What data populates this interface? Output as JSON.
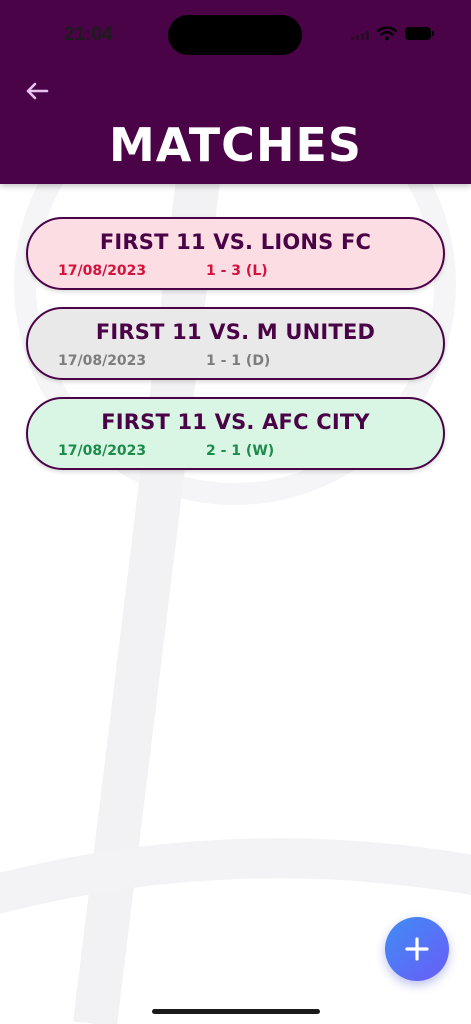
{
  "status_bar": {
    "time": "21:04"
  },
  "header": {
    "title": "MATCHES"
  },
  "colors": {
    "brand": "#4a0347",
    "loss_bg": "#fddde4",
    "loss_text": "#d4123c",
    "draw_bg": "#e9e9e9",
    "draw_text": "#7d7d7d",
    "win_bg": "#d9f6e5",
    "win_text": "#1c8c4a",
    "fab": "#5a74f5"
  },
  "matches": [
    {
      "title": "FIRST 11 VS. LIONS FC",
      "date": "17/08/2023",
      "score": "1 - 3 (L)",
      "result": "loss"
    },
    {
      "title": "FIRST 11 VS. M UNITED",
      "date": "17/08/2023",
      "score": "1 - 1 (D)",
      "result": "draw"
    },
    {
      "title": "FIRST 11 VS. AFC CITY",
      "date": "17/08/2023",
      "score": "2 - 1 (W)",
      "result": "win"
    }
  ],
  "icons": {
    "back": "arrow-left-icon",
    "add": "plus-icon"
  }
}
